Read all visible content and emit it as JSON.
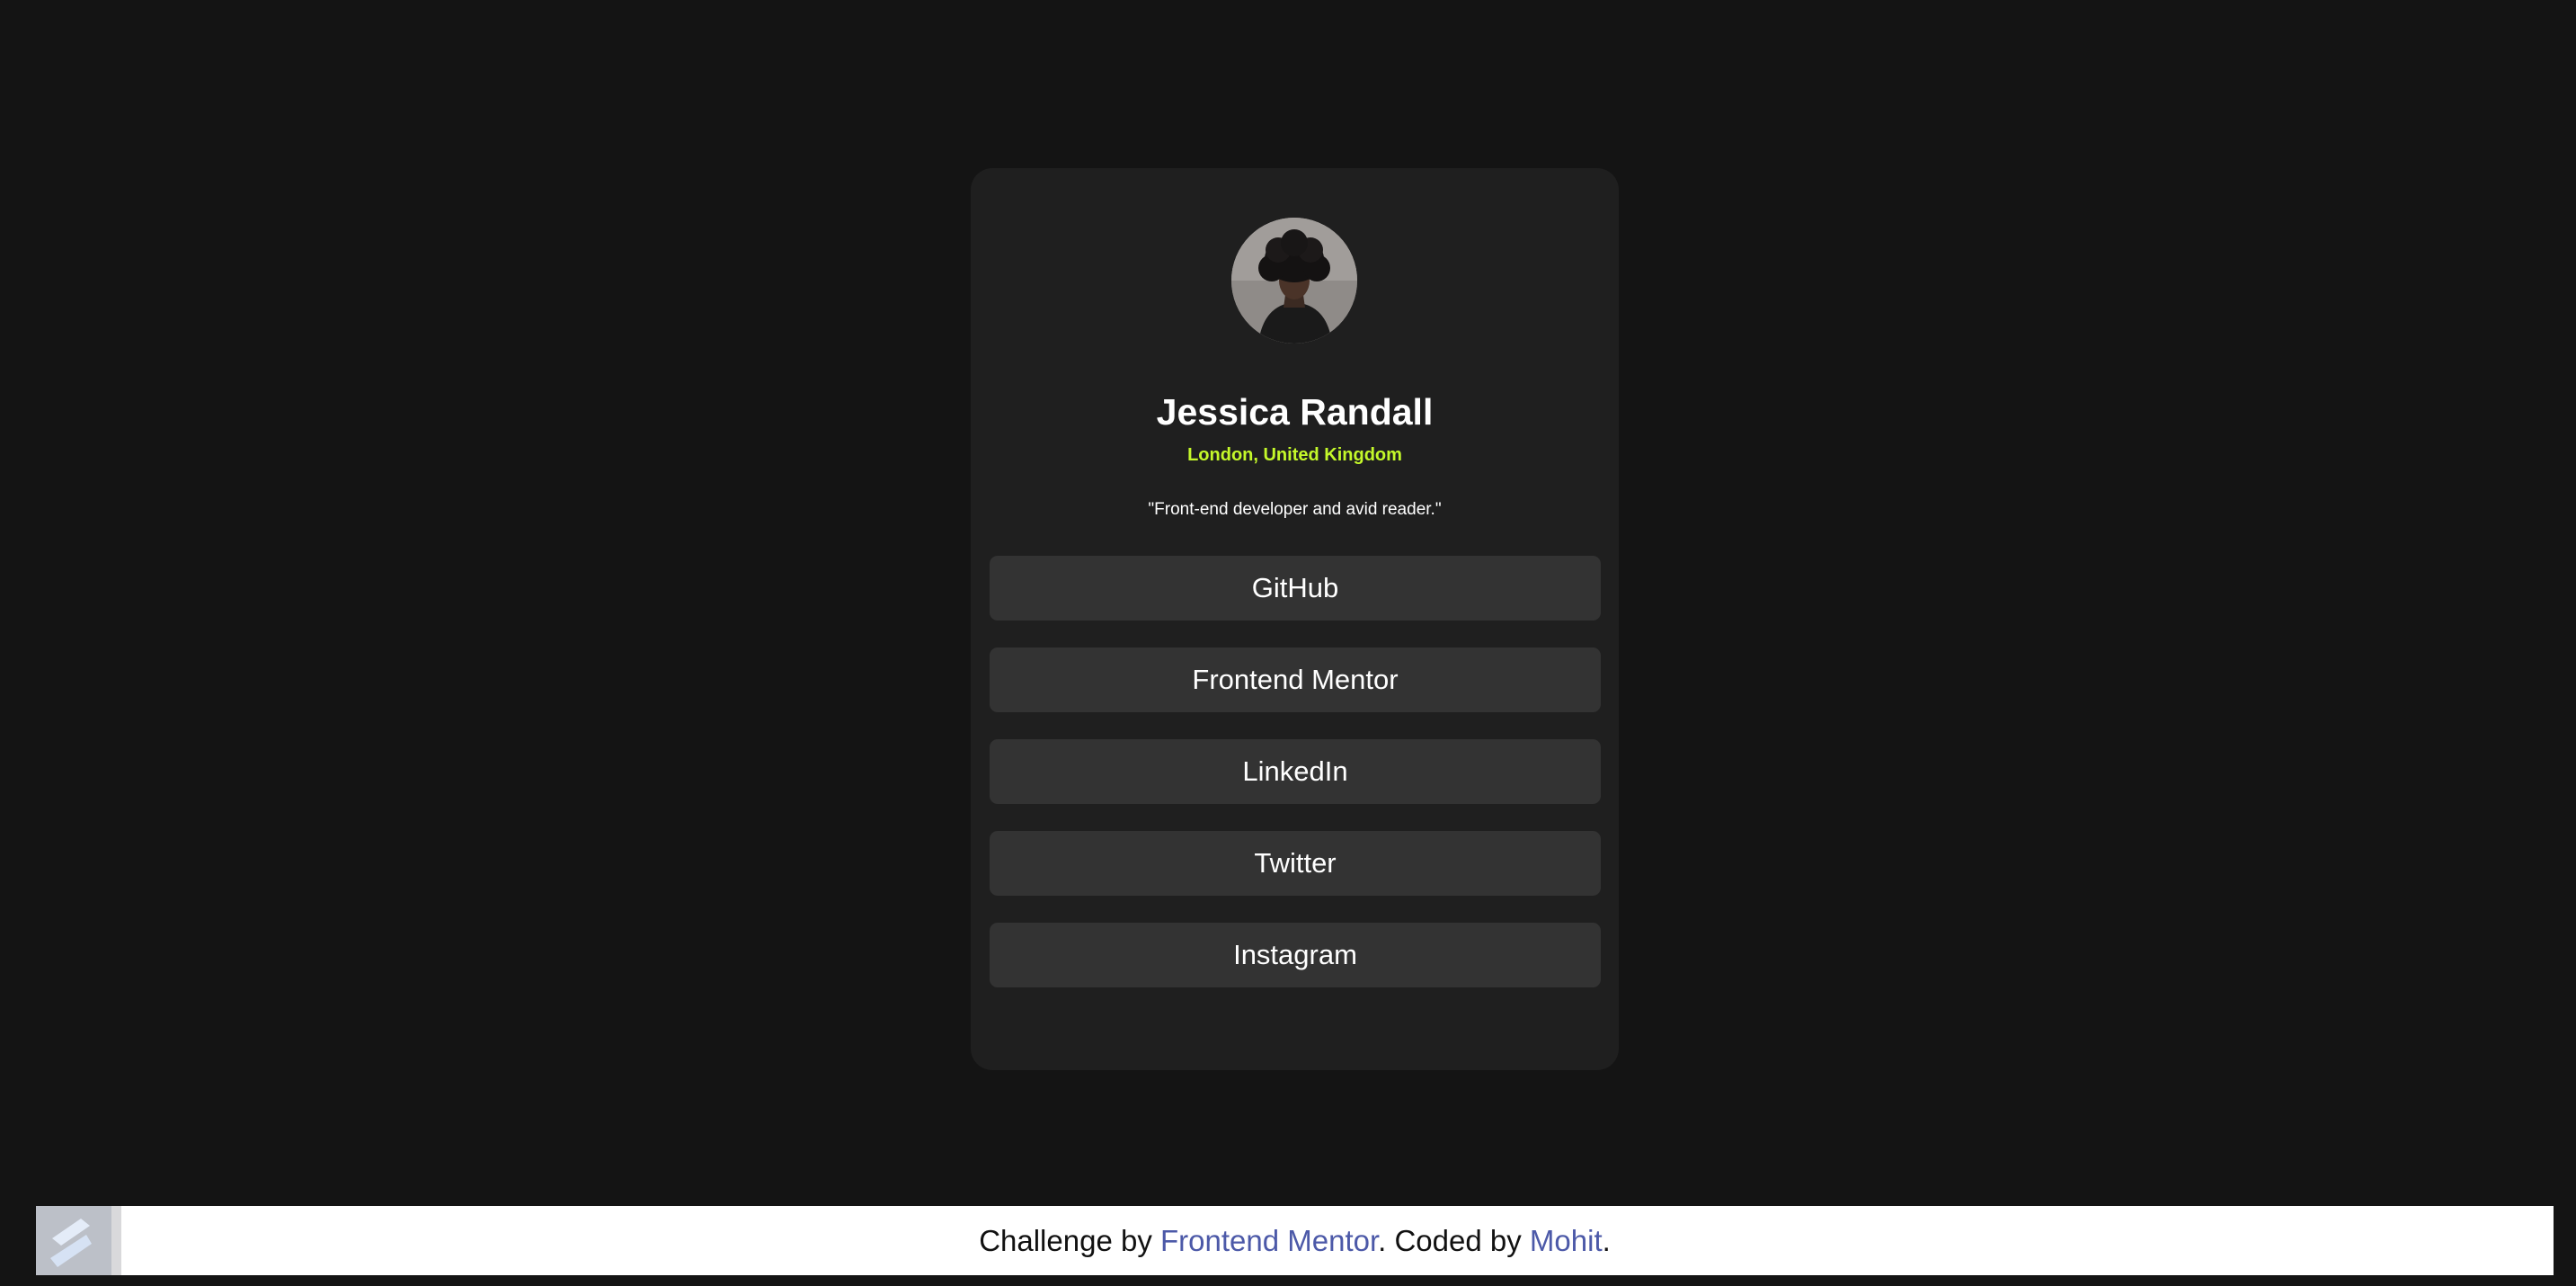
{
  "profile": {
    "name": "Jessica Randall",
    "location": "London, United Kingdom",
    "bio": "\"Front-end developer and avid reader.\""
  },
  "links": [
    {
      "label": "GitHub"
    },
    {
      "label": "Frontend Mentor"
    },
    {
      "label": "LinkedIn"
    },
    {
      "label": "Twitter"
    },
    {
      "label": "Instagram"
    }
  ],
  "attribution": {
    "prefix": "Challenge by ",
    "challenge_link": "Frontend Mentor",
    "middle": ". Coded by ",
    "author_link": "Mohit",
    "suffix": "."
  },
  "colors": {
    "page_background": "#141414",
    "card_background": "#1f1f1f",
    "button_background": "#333333",
    "accent": "#c4f82a",
    "link_color": "#4c59a8"
  },
  "icons": {
    "badge": "frontend-mentor-logo-icon"
  }
}
